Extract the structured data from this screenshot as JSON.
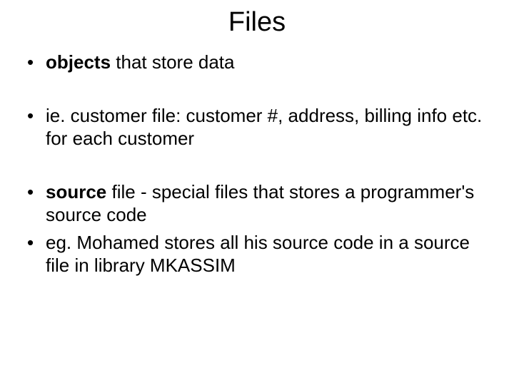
{
  "slide": {
    "title": "Files",
    "bullets": [
      {
        "bold": "objects",
        "rest": " that store data"
      },
      {
        "bold": "",
        "rest": "ie. customer file: customer #, address, billing info etc. for each customer"
      },
      {
        "bold": "source",
        "rest": " file - special files that stores a programmer's source code"
      },
      {
        "bold": "",
        "rest": ""
      },
      {
        "bold": "",
        "rest": "eg. Mohamed stores all his source code in a source file in library MKASSIM"
      }
    ]
  }
}
